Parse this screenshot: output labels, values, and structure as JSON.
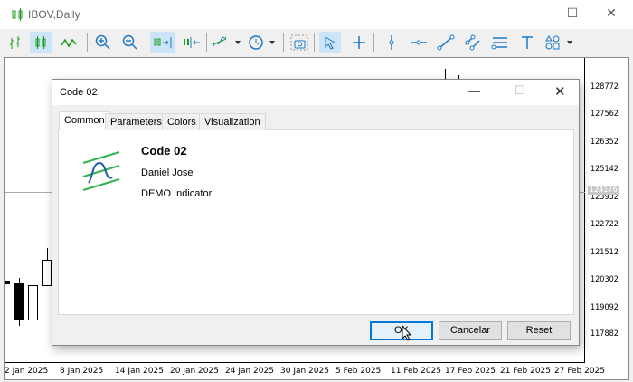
{
  "window": {
    "title": "IBOV,Daily",
    "minimize": "—",
    "maximize": "☐",
    "close": "✕"
  },
  "toolbar": [
    "bar-chart",
    "candlesticks",
    "line-chart",
    "zoom-in",
    "zoom-out",
    "chart-shift",
    "autoscroll",
    "indicators",
    "timeframes",
    "screenshot",
    "cursor",
    "crosshair",
    "vertical-line",
    "horizontal-line",
    "trendline",
    "equidistant-channel",
    "fibonacci",
    "text",
    "shapes"
  ],
  "chart": {
    "price_labels": [
      "128772",
      "127562",
      "126352",
      "125142",
      "123932",
      "122722",
      "121512",
      "120302",
      "119092",
      "117882"
    ],
    "current_price": "124176",
    "date_labels": [
      "2 Jan 2025",
      "8 Jan 2025",
      "14 Jan 2025",
      "20 Jan 2025",
      "24 Jan 2025",
      "30 Jan 2025",
      "5 Feb 2025",
      "11 Feb 2025",
      "17 Feb 2025",
      "21 Feb 2025",
      "27 Feb 2025"
    ]
  },
  "dialog": {
    "title": "Code 02",
    "tabs": [
      "Common",
      "Parameters",
      "Colors",
      "Visualization"
    ],
    "name": "Code 02",
    "author": "Daniel Jose",
    "description": "DEMO Indicator",
    "ok": "OK",
    "cancel": "Cancelar",
    "reset": "Reset",
    "close": "✕",
    "minimize": "—",
    "maximize": "☐"
  }
}
